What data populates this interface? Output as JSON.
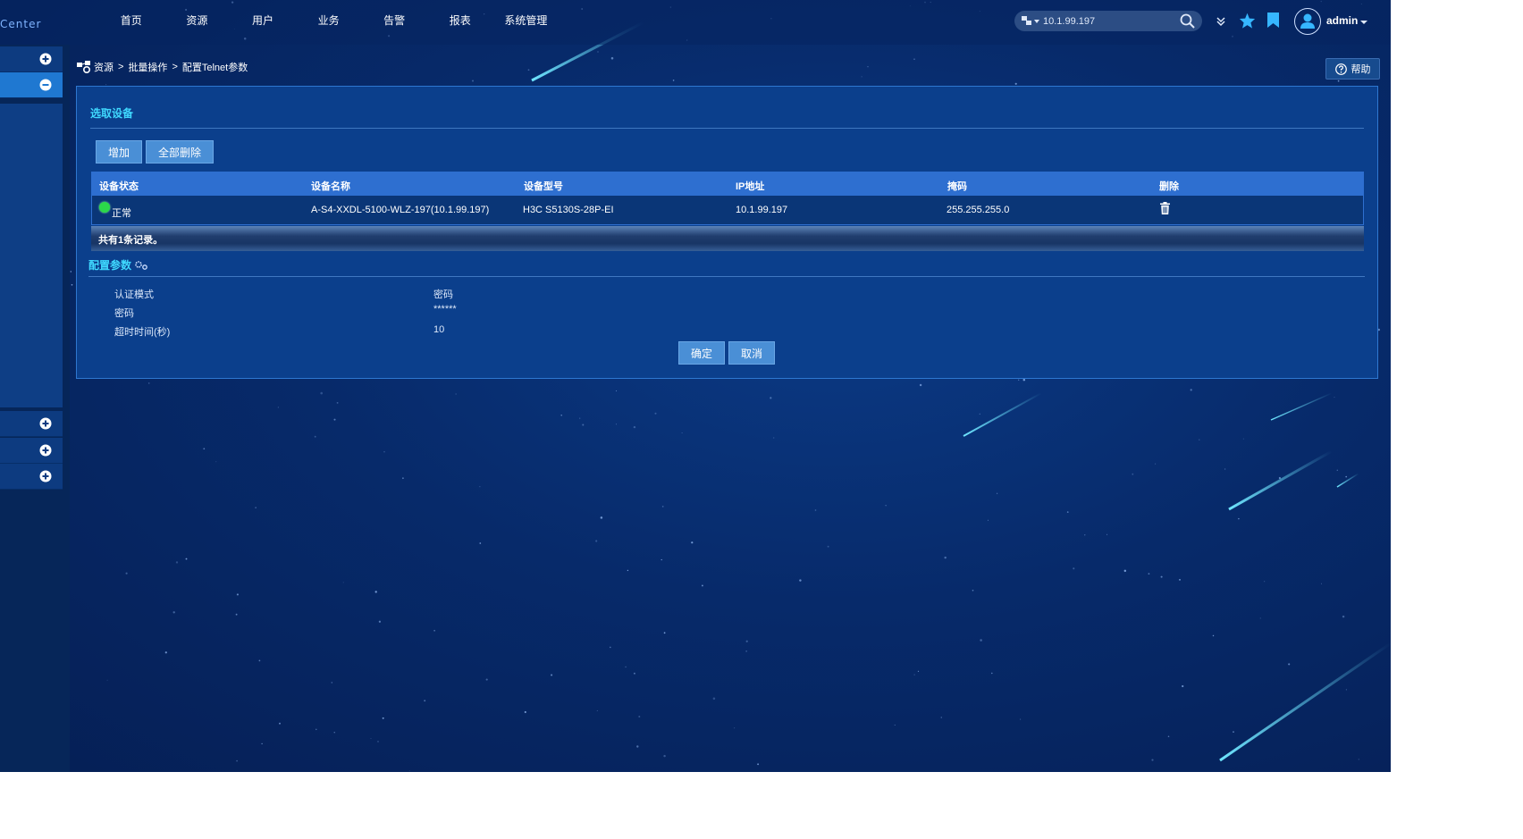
{
  "brand": {
    "text": "Center"
  },
  "nav": {
    "items": [
      "首页",
      "资源",
      "用户",
      "业务",
      "告警",
      "报表",
      "系统管理"
    ]
  },
  "search": {
    "value": "10.1.99.197"
  },
  "user": {
    "name": "admin"
  },
  "breadcrumb": {
    "items": [
      "资源",
      "批量操作",
      "配置Telnet参数"
    ],
    "separator": ">"
  },
  "help": {
    "label": "帮助"
  },
  "select_device": {
    "title": "选取设备",
    "add_label": "增加",
    "delete_all_label": "全部删除",
    "columns": [
      "设备状态",
      "设备名称",
      "设备型号",
      "IP地址",
      "掩码",
      "删除"
    ],
    "rows": [
      {
        "status": "正常",
        "name": "A-S4-XXDL-5100-WLZ-197(10.1.99.197)",
        "model": "H3C S5130S-28P-EI",
        "ip": "10.1.99.197",
        "mask": "255.255.255.0"
      }
    ],
    "footer": "共有1条记录。"
  },
  "config": {
    "title": "配置参数",
    "params": [
      {
        "label": "认证模式",
        "value": "密码"
      },
      {
        "label": "密码",
        "value": "******"
      },
      {
        "label": "超时时间(秒)",
        "value": "10"
      }
    ],
    "ok_label": "确定",
    "cancel_label": "取消"
  },
  "colors": {
    "accent": "#3fd9ff",
    "status_ok": "#2bd84a",
    "button": "#4a8fd6",
    "table_header": "#2e6fd0"
  }
}
